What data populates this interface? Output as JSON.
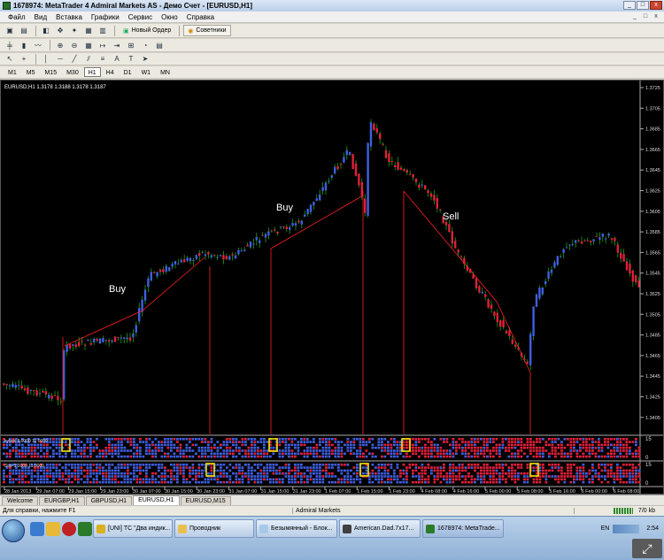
{
  "window": {
    "title": "1678974: MetaTrader 4 Admiral Markets AS - Демо Счет - [EURUSD,H1]",
    "buttons": [
      "_",
      "□",
      "x"
    ]
  },
  "menu": {
    "items": [
      "Файл",
      "Вид",
      "Вставка",
      "Графики",
      "Сервис",
      "Окно",
      "Справка"
    ],
    "mdi_buttons": [
      "_",
      "□",
      "x"
    ]
  },
  "toolbar": {
    "new_order": "Новый Ордер",
    "experts": "Советники"
  },
  "line_tools": {
    "text_tool": "A",
    "label_tool": "T"
  },
  "timeframes": [
    "M1",
    "M5",
    "M15",
    "M30",
    "H1",
    "H4",
    "D1",
    "W1",
    "MN"
  ],
  "active_timeframe": "H1",
  "chart": {
    "header": "EURUSD,H1  1.3178 1.3188 1.3178 1.3187",
    "price_ticks": [
      "1.3725",
      "1.3705",
      "1.3685",
      "1.3665",
      "1.3645",
      "1.3625",
      "1.3605",
      "1.3585",
      "1.3565",
      "1.3545",
      "1.3525",
      "1.3505",
      "1.3485",
      "1.3465",
      "1.3445",
      "1.3425",
      "1.3405"
    ],
    "time_ticks": [
      "28 Jan 2013",
      "29 Jan 07:00",
      "29 Jan 15:00",
      "29 Jan 23:00",
      "30 Jan 07:00",
      "30 Jan 15:00",
      "30 Jan 23:00",
      "31 Jan 07:00",
      "31 Jan 15:00",
      "31 Jan 23:00",
      "1 Feb 07:00",
      "1 Feb 15:00",
      "1 Feb 23:00",
      "4 Feb 08:00",
      "4 Feb 16:00",
      "5 Feb 00:00",
      "5 Feb 08:00",
      "5 Feb 16:00",
      "6 Feb 00:00",
      "6 Feb 08:00"
    ],
    "annotations": [
      "Buy",
      "Buy",
      "Sell"
    ],
    "indicator1": {
      "label": "kybok 8.0000 11.0000",
      "scale": [
        "15",
        "0"
      ]
    },
    "indicator2": {
      "label": "Star 5.0000 11.0000",
      "scale": [
        "15",
        "0"
      ]
    },
    "colors": {
      "bull": "#3f5fe0",
      "bear": "#e0203a",
      "wick": "#1aa01a",
      "signal": "#ff2020",
      "highlight": "#f2e600"
    }
  },
  "chart_data": {
    "type": "candlestick",
    "symbol": "EURUSD",
    "timeframe": "H1",
    "last_quote": {
      "open": 1.3178,
      "high": 1.3188,
      "low": 1.3178,
      "close": 1.3187
    },
    "ylim": [
      1.3395,
      1.3735
    ]
  },
  "tabs": [
    "Welcome",
    "EURGBP,H1",
    "GBPUSD,H1",
    "EURUSD,H1",
    "EURUSD,M15"
  ],
  "active_tab": "EURUSD,H1",
  "status": {
    "help": "Для справки, нажмите F1",
    "broker": "Admiral Markets",
    "traffic": "7/0 kb"
  },
  "taskbar": {
    "tasks": [
      "[UNI] ТС \"Два индик...",
      "Проводник",
      "Безымянный - Блок...",
      "American.Dad.7x17...",
      "1678974: MetaTrade..."
    ],
    "lang": "EN",
    "time": "2:54"
  }
}
